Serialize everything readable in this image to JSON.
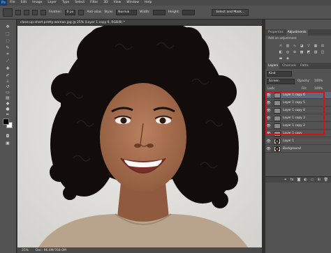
{
  "menubar": {
    "logo": "Ps",
    "items": [
      "File",
      "Edit",
      "Image",
      "Layer",
      "Type",
      "Select",
      "Filter",
      "3D",
      "View",
      "Window",
      "Help"
    ]
  },
  "options": {
    "feather_label": "Feather:",
    "feather_value": "0 px",
    "antialias_label": "Anti-alias",
    "style_label": "Style:",
    "style_value": "Normal",
    "width_label": "Width:",
    "height_label": "Height:",
    "select_mask_label": "Select and Mask..."
  },
  "document": {
    "tab_title": "close-up-short-pretty-woman.jpg @ 25% (Layer 1 copy 6, RGB/8) *",
    "zoom": "25%",
    "doc_size": "Doc: 96.0M/768.0M"
  },
  "adjustments_panel": {
    "tabs": [
      "Properties",
      "Adjustments"
    ],
    "active_tab": "Adjustments",
    "subtitle": "Add an adjustment",
    "icons": [
      "brightness-icon",
      "levels-icon",
      "curves-icon",
      "exposure-icon",
      "vibrance-icon",
      "hue-icon",
      "balance-icon",
      "bw-icon",
      "photo-filter-icon",
      "channel-mixer-icon",
      "lookup-icon",
      "invert-icon",
      "posterize-icon",
      "threshold-icon",
      "gradient-map-icon",
      "selective-color-icon"
    ]
  },
  "layers_panel": {
    "tabs": [
      "Layers",
      "Channels",
      "Paths"
    ],
    "active_tab": "Layers",
    "filter_kind": "Kind",
    "blend_mode": "Screen",
    "opacity_label": "Opacity:",
    "opacity_value": "100%",
    "lock_label": "Lock:",
    "fill_label": "Fill:",
    "fill_value": "100%",
    "layers": [
      {
        "name": "Layer 1 copy 6",
        "selected": true,
        "portrait": false
      },
      {
        "name": "Layer 1 copy 5",
        "selected": false,
        "portrait": false
      },
      {
        "name": "Layer 1 copy 4",
        "selected": false,
        "portrait": false
      },
      {
        "name": "Layer 1 copy 3",
        "selected": false,
        "portrait": false
      },
      {
        "name": "Layer 1 copy 2",
        "selected": false,
        "portrait": false
      },
      {
        "name": "Layer 1 copy",
        "selected": false,
        "portrait": false
      },
      {
        "name": "Layer 1",
        "selected": false,
        "portrait": true
      },
      {
        "name": "Background",
        "selected": false,
        "portrait": true
      }
    ]
  },
  "colors": {
    "panel": "#535353",
    "highlight": "#d8101b",
    "selection": "#5f6a78"
  }
}
